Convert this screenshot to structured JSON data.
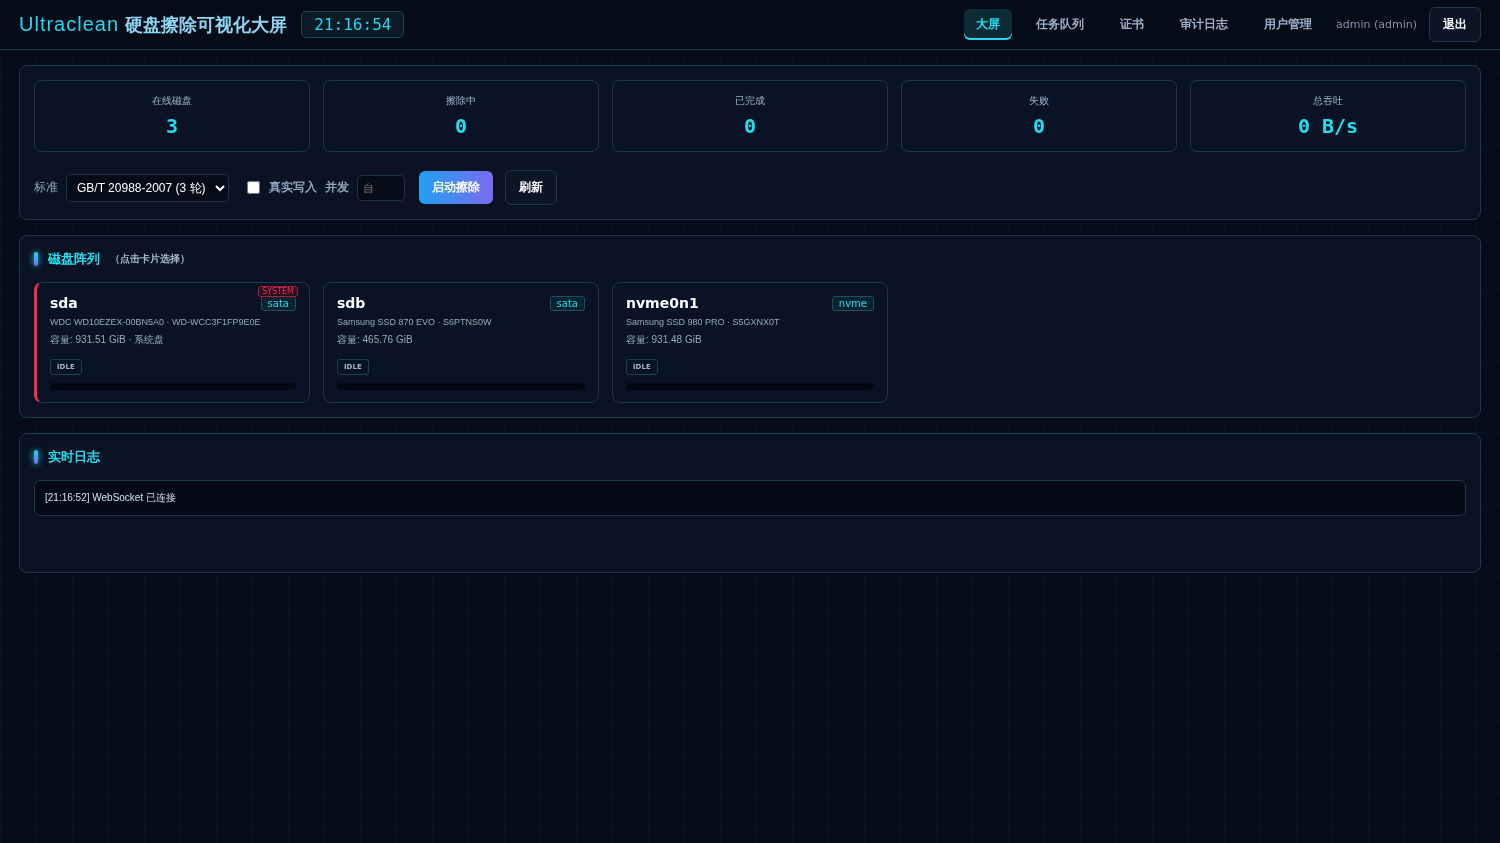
{
  "header": {
    "brand": "Ultraclean",
    "title": "硬盘擦除可视化大屏",
    "clock": "21:16:54",
    "nav": [
      {
        "label": "大屏",
        "selected": true
      },
      {
        "label": "任务队列",
        "selected": false
      },
      {
        "label": "证书",
        "selected": false
      },
      {
        "label": "审计日志",
        "selected": false
      },
      {
        "label": "用户管理",
        "selected": false
      }
    ],
    "user": "admin (admin)",
    "logout": "退出"
  },
  "stats": [
    {
      "label": "在线磁盘",
      "value": "3"
    },
    {
      "label": "擦除中",
      "value": "0"
    },
    {
      "label": "已完成",
      "value": "0"
    },
    {
      "label": "失败",
      "value": "0"
    },
    {
      "label": "总吞吐",
      "value": "0 B/s"
    }
  ],
  "controls": {
    "standard_label": "标准",
    "standard": "GB/T 20988-2007 (3 轮)",
    "real_write": {
      "label": "真实写入",
      "checked": false
    },
    "concurrency_label": "并发",
    "concurrency_placeholder": "自",
    "start": "启动擦除",
    "refresh": "刷新"
  },
  "disks": {
    "title": "磁盘阵列",
    "hint": "（点击卡片选择）",
    "items": [
      {
        "name": "sda",
        "bus": "sata",
        "system": true,
        "system_label": "SYSTEM",
        "model": "WDC WD10EZEX-00BN5A0 · WD-WCC3F1FP9E0E",
        "capacity": "容量: 931.51 GiB · 系统盘",
        "status": "IDLE",
        "level": 0
      },
      {
        "name": "sdb",
        "bus": "sata",
        "system": false,
        "model": "Samsung SSD 870 EVO · S6PTNS0W",
        "capacity": "容量: 465.76 GiB",
        "status": "IDLE",
        "level": 0
      },
      {
        "name": "nvme0n1",
        "bus": "nvme",
        "system": false,
        "model": "Samsung SSD 980 PRO · S5GXNX0T",
        "capacity": "容量: 931.48 GiB",
        "status": "IDLE",
        "level": 0
      }
    ]
  },
  "log": {
    "title": "实时日志",
    "lines": [
      "[21:16:52] WebSocket 已连接"
    ]
  }
}
